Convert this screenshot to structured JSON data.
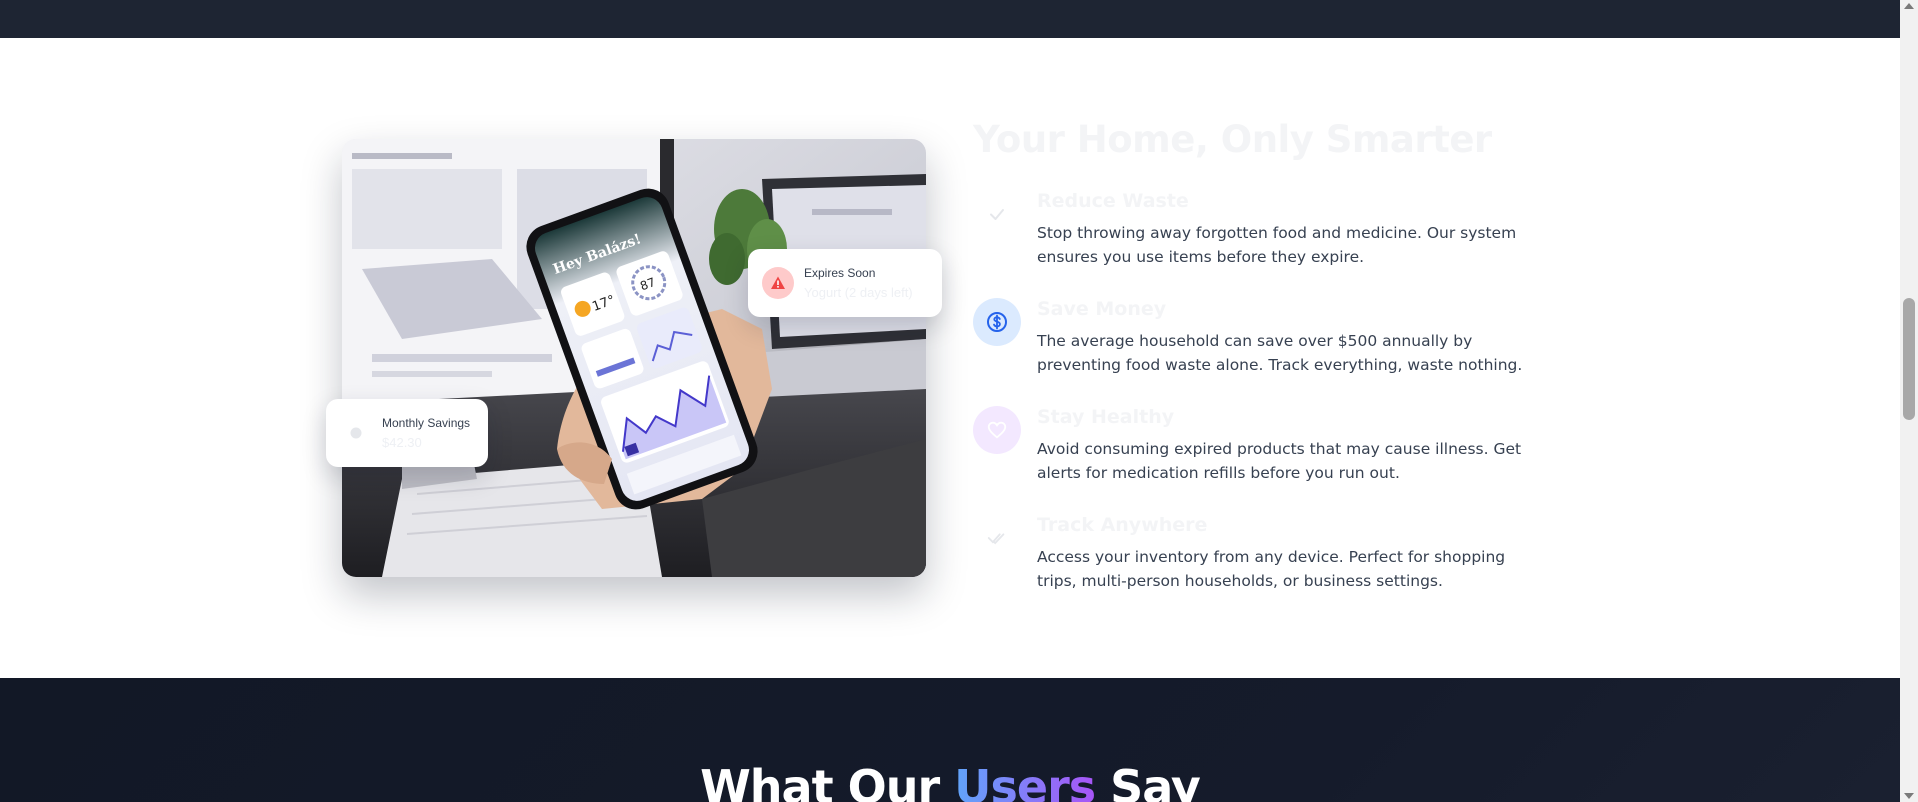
{
  "colors": {
    "top_band": "#1e2533",
    "bottom_band": "#121826",
    "accent_blue": "#2563eb",
    "accent_purple": "#a855f7",
    "warning_red": "#ef4444",
    "body_text": "#374151"
  },
  "benefits": {
    "heading": "Your Home, Only Smarter",
    "items": [
      {
        "icon": "check-icon",
        "title": "Reduce Waste",
        "description": "Stop throwing away forgotten food and medicine. Our system ensures you use items before they expire."
      },
      {
        "icon": "dollar-icon",
        "title": "Save Money",
        "description": "The average household can save over $500 annually by preventing food waste alone. Track everything, waste nothing."
      },
      {
        "icon": "heart-icon",
        "title": "Stay Healthy",
        "description": "Avoid consuming expired products that may cause illness. Get alerts for medication refills before you run out."
      },
      {
        "icon": "double-check-icon",
        "title": "Track Anywhere",
        "description": "Access your inventory from any device. Perfect for shopping trips, multi-person households, or business settings."
      }
    ]
  },
  "floating_cards": {
    "expires": {
      "icon": "warning-icon",
      "label": "Expires Soon",
      "value": "Yogurt (2 days left)"
    },
    "savings": {
      "icon": "piggy-bank-icon",
      "label": "Monthly Savings",
      "value": "$42.30"
    }
  },
  "phone_screen": {
    "greeting": "Hey Balázs!",
    "temperature": "17°",
    "air_quality": "87"
  },
  "testimonials": {
    "heading_before": "What Our ",
    "heading_highlight": "Users",
    "heading_after": " Say"
  }
}
